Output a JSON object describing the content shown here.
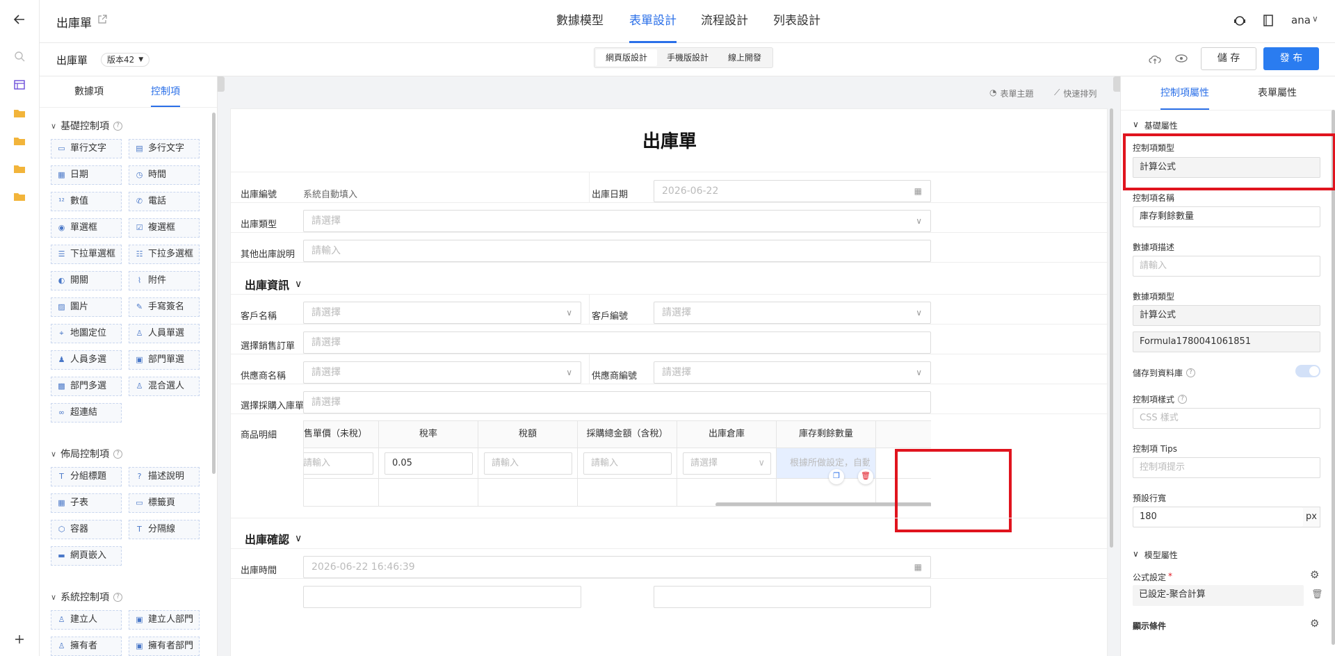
{
  "app": {
    "page_title": "出庫單",
    "user": "ana"
  },
  "top_nav": [
    {
      "label": "數據模型"
    },
    {
      "label": "表單設計"
    },
    {
      "label": "流程設計"
    },
    {
      "label": "列表設計"
    }
  ],
  "subbar": {
    "form_name": "出庫單",
    "version": "版本42",
    "modes": [
      {
        "label": "網頁版設計"
      },
      {
        "label": "手機版設計"
      },
      {
        "label": "線上開發"
      }
    ],
    "save": "儲 存",
    "publish": "發 布"
  },
  "left_panel": {
    "tabs": [
      {
        "label": "數據項"
      },
      {
        "label": "控制項"
      }
    ],
    "groups": [
      {
        "title": "基礎控制項",
        "items": [
          {
            "label": "單行文字",
            "icon": "text-single-icon"
          },
          {
            "label": "多行文字",
            "icon": "text-multi-icon"
          },
          {
            "label": "日期",
            "icon": "calendar-icon"
          },
          {
            "label": "時間",
            "icon": "clock-icon"
          },
          {
            "label": "數值",
            "icon": "number-icon"
          },
          {
            "label": "電話",
            "icon": "phone-icon"
          },
          {
            "label": "單選框",
            "icon": "radio-icon"
          },
          {
            "label": "複選框",
            "icon": "checkbox-icon"
          },
          {
            "label": "下拉單選框",
            "icon": "dropdown-single-icon"
          },
          {
            "label": "下拉多選框",
            "icon": "dropdown-multi-icon"
          },
          {
            "label": "開關",
            "icon": "toggle-icon"
          },
          {
            "label": "附件",
            "icon": "paperclip-icon"
          },
          {
            "label": "圖片",
            "icon": "image-icon"
          },
          {
            "label": "手寫簽名",
            "icon": "pen-icon"
          },
          {
            "label": "地圖定位",
            "icon": "location-icon"
          },
          {
            "label": "人員單選",
            "icon": "user-icon"
          },
          {
            "label": "人員多選",
            "icon": "users-icon"
          },
          {
            "label": "部門單選",
            "icon": "dept-icon"
          },
          {
            "label": "部門多選",
            "icon": "dept-multi-icon"
          },
          {
            "label": "混合選人",
            "icon": "user-mix-icon"
          },
          {
            "label": "超連結",
            "icon": "link-icon"
          }
        ]
      },
      {
        "title": "佈局控制項",
        "items": [
          {
            "label": "分組標題",
            "icon": "title-icon"
          },
          {
            "label": "描述說明",
            "icon": "help-icon"
          },
          {
            "label": "子表",
            "icon": "table-icon"
          },
          {
            "label": "標籤頁",
            "icon": "tabs-icon"
          },
          {
            "label": "容器",
            "icon": "box-icon"
          },
          {
            "label": "分隔線",
            "icon": "divider-icon"
          },
          {
            "label": "網頁嵌入",
            "icon": "embed-icon"
          }
        ]
      },
      {
        "title": "系統控制項",
        "items": [
          {
            "label": "建立人",
            "icon": "user-icon"
          },
          {
            "label": "建立人部門",
            "icon": "dept-icon"
          },
          {
            "label": "擁有者",
            "icon": "user-icon"
          },
          {
            "label": "擁有者部門",
            "icon": "dept-icon"
          }
        ]
      }
    ]
  },
  "canvas": {
    "toolbar": {
      "theme": "表單主題",
      "arrange": "快速排列"
    },
    "form_title": "出庫單",
    "fields": {
      "no_label": "出庫編號",
      "no_value": "系統自動填入",
      "date_label": "出庫日期",
      "date_value": "2026-06-22",
      "type_label": "出庫類型",
      "type_ph": "請選擇",
      "note_label": "其他出庫說明",
      "note_ph": "請輸入"
    },
    "section1": {
      "title": "出庫資訊",
      "customer_label": "客戶名稱",
      "customer_ph": "請選擇",
      "custno_label": "客戶編號",
      "custno_ph": "請選擇",
      "so_label": "選擇銷售訂單",
      "so_ph": "請選擇",
      "supplier_label": "供應商名稱",
      "supplier_ph": "請選擇",
      "supno_label": "供應商編號",
      "supno_ph": "請選擇",
      "pi_label": "選擇採購入庫單",
      "pi_ph": "請選擇",
      "detail_label": "商品明細"
    },
    "subtable": {
      "columns": [
        "售單價（未稅）",
        "稅率",
        "稅額",
        "採購總金額（含稅）",
        "出庫倉庫",
        "庫存剩餘數量"
      ],
      "row": [
        "請輸入",
        "0.05",
        "請輸入",
        "請輸入",
        "請選擇",
        "根據所做設定，自動..."
      ]
    },
    "section2": {
      "title": "出庫確認",
      "time_label": "出庫時間",
      "time_value": "2026-06-22 16:46:39"
    }
  },
  "right_panel": {
    "tabs": [
      {
        "label": "控制項屬性"
      },
      {
        "label": "表單屬性"
      }
    ],
    "basic_title": "基礎屬性",
    "ctrl_type_label": "控制項類型",
    "ctrl_type_value": "計算公式",
    "ctrl_name_label": "控制項名稱",
    "ctrl_name_value": "庫存剩餘數量",
    "data_desc_label": "數據項描述",
    "data_desc_ph": "請輸入",
    "data_type_label": "數據項類型",
    "data_type_value": "計算公式",
    "data_id_value": "Formula1780041061851",
    "store_label": "儲存到資料庫",
    "style_label": "控制項樣式",
    "style_ph": "CSS 樣式",
    "tips_label": "控制項 Tips",
    "tips_ph": "控制項提示",
    "width_label": "預設行寬",
    "width_value": "180",
    "width_unit": "px",
    "model_title": "模型屬性",
    "formula_label": "公式設定",
    "formula_value": "已設定-聚合計算",
    "display_label": "顯示條件"
  }
}
